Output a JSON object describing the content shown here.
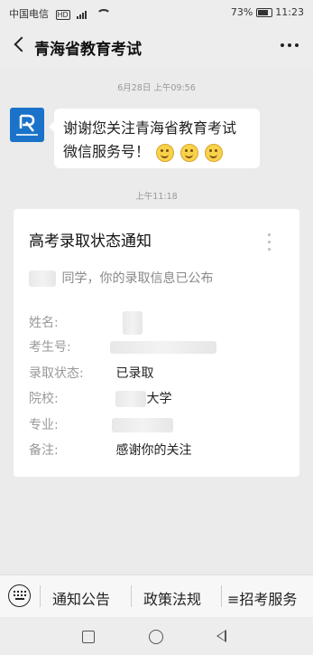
{
  "statusbar": {
    "carrier": "中国电信",
    "network_badge": "HD",
    "battery": "73%",
    "time": "11:23"
  },
  "header": {
    "title": "青海省教育考试",
    "more_icon": "more-dots-icon",
    "back_icon": "back-arrow-icon"
  },
  "chat": {
    "timestamp1": "6月28日 上午09:56",
    "welcome_line1": "谢谢您关注青海省教育考试",
    "welcome_line2": "微信服务号！",
    "timestamp2": "上午11:18"
  },
  "card": {
    "title": "高考录取状态通知",
    "greeting": "同学，你的录取信息已公布",
    "fields": [
      {
        "label": "姓名:",
        "value": ""
      },
      {
        "label": "考生号:",
        "value": ""
      },
      {
        "label": "录取状态:",
        "value": "已录取"
      },
      {
        "label": "院校:",
        "value": "大学"
      },
      {
        "label": "专业:",
        "value": ""
      },
      {
        "label": "备注:",
        "value": "感谢你的关注"
      }
    ]
  },
  "menu": {
    "items": [
      "通知公告",
      "政策法规",
      "≡招考服务"
    ]
  },
  "colors": {
    "accent": "#1a73c9",
    "background": "#ebebeb"
  }
}
